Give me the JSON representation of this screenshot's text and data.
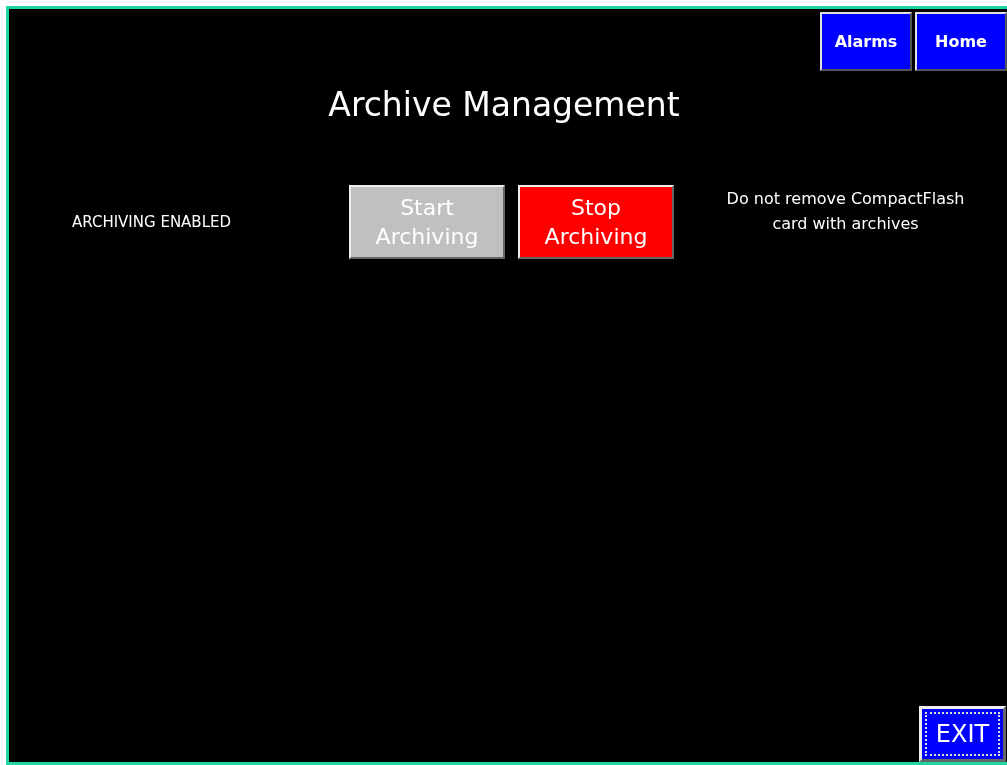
{
  "nav_buttons": [
    {
      "label": "Alarms"
    },
    {
      "label": "Home"
    }
  ],
  "title": "Archive Management",
  "status": "ARCHIVING ENABLED",
  "action_buttons": [
    {
      "label": "Start\nArchiving",
      "color": "#c0c0c0"
    },
    {
      "label": "Stop\nArchiving",
      "color": "#ff0000"
    }
  ],
  "note": "Do not remove CompactFlash\ncard with archives",
  "exit_button": {
    "label": "EXIT",
    "focused": true
  }
}
